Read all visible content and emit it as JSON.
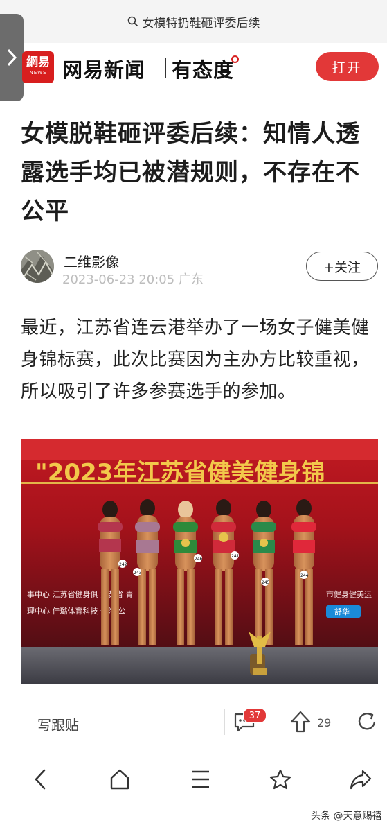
{
  "search": {
    "query": "女模特扔鞋砸评委后续"
  },
  "header": {
    "logo_line1": "網易",
    "logo_line2": "NEWS",
    "brand_name": "网易新闻",
    "brand_slogan": "有态度",
    "open_label": "打开",
    "accent_color": "#e23838"
  },
  "article": {
    "title": "女模脱鞋砸评委后续：知情人透露选手均已被潜规则，不存在不公平",
    "author": "二维影像",
    "date": "2023-06-23 20:05",
    "location": "广东",
    "follow_label": "+关注",
    "paragraph": "最近，江苏省连云港举办了一场女子健美健身锦标赛，此次比赛因为主办方比较重视，所以吸引了许多参赛选手的参加。",
    "photo": {
      "banner_text": "\"2023年江苏省健美健身锦",
      "sponsor_line1": "事中心   江苏省健身俱    江苏省    青",
      "sponsor_line2": "理中心   佳璐体育科技    云港    公",
      "sponsor_line3": "市健身健美运",
      "sponsor_logo": "舒华",
      "bib_numbers": [
        "242",
        "243",
        "246",
        "241",
        "245",
        "244"
      ]
    }
  },
  "actions": {
    "reply_label": "写跟贴",
    "comment_count": "37",
    "upvote_count": "29"
  },
  "browser_nav": {
    "icons": [
      "back-icon",
      "home-icon",
      "menu-icon",
      "star-icon",
      "share-icon"
    ]
  },
  "watermark": {
    "text": "头条 @天意赐禧"
  }
}
